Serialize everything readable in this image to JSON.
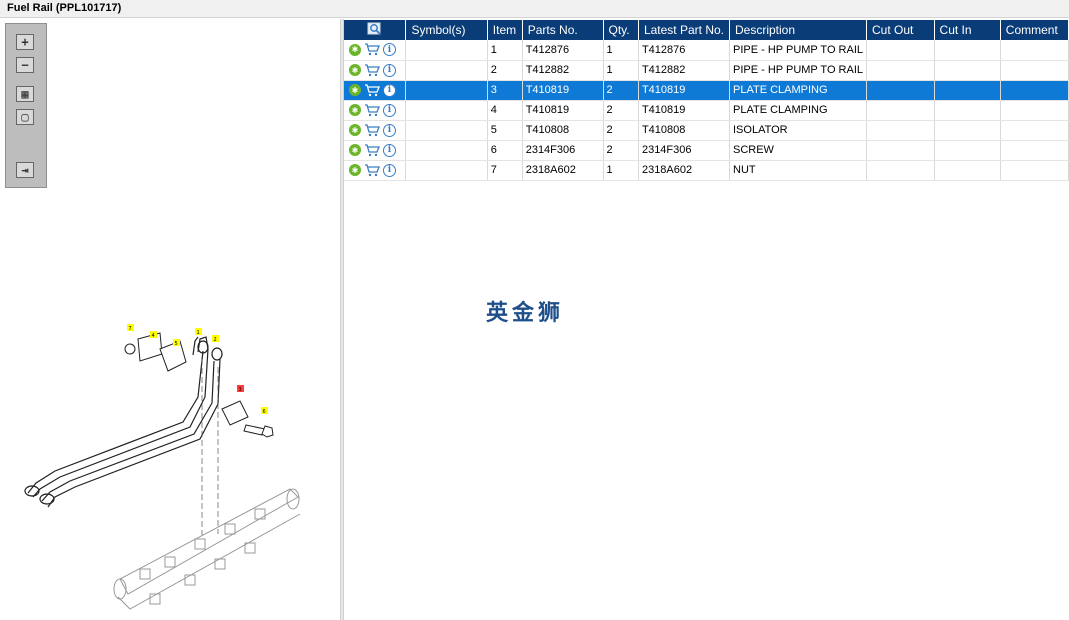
{
  "window": {
    "title": "Fuel Rail (PPL101717)"
  },
  "toolbox": {
    "buttons": [
      {
        "name": "zoom-in-button",
        "glyph": "+"
      },
      {
        "name": "zoom-out-button",
        "glyph": "−"
      },
      {
        "name": "thumbnails-button",
        "glyph": "▦"
      },
      {
        "name": "fit-button",
        "glyph": "▢"
      },
      {
        "name": "layout-button",
        "glyph": "⇥"
      }
    ]
  },
  "diagram": {
    "callouts": [
      "7",
      "4",
      "5",
      "1",
      "2",
      "3",
      "6"
    ],
    "highlight_color": "#ff3b3b",
    "callout_color": "#ffff00"
  },
  "table": {
    "headers": [
      "",
      "Symbol(s)",
      "Item",
      "Parts No.",
      "Qty.",
      "Latest Part No.",
      "Description",
      "Cut Out",
      "Cut In",
      "Comment"
    ],
    "rows": [
      {
        "item": "1",
        "part": "T412876",
        "qty": "1",
        "latest": "T412876",
        "desc": "PIPE - HP PUMP TO RAIL",
        "selected": false
      },
      {
        "item": "2",
        "part": "T412882",
        "qty": "1",
        "latest": "T412882",
        "desc": "PIPE - HP PUMP TO RAIL",
        "selected": false
      },
      {
        "item": "3",
        "part": "T410819",
        "qty": "2",
        "latest": "T410819",
        "desc": "PLATE CLAMPING",
        "selected": true
      },
      {
        "item": "4",
        "part": "T410819",
        "qty": "2",
        "latest": "T410819",
        "desc": "PLATE CLAMPING",
        "selected": false
      },
      {
        "item": "5",
        "part": "T410808",
        "qty": "2",
        "latest": "T410808",
        "desc": "ISOLATOR",
        "selected": false
      },
      {
        "item": "6",
        "part": "2314F306",
        "qty": "2",
        "latest": "2314F306",
        "desc": "SCREW",
        "selected": false
      },
      {
        "item": "7",
        "part": "2318A602",
        "qty": "1",
        "latest": "2318A602",
        "desc": "NUT",
        "selected": false
      }
    ]
  },
  "watermark": "英金狮",
  "colors": {
    "header_bg": "#0a3c78",
    "selected_row": "#0f7ad6",
    "gear_green": "#6bb52a",
    "cart_blue": "#3a7cc4"
  }
}
